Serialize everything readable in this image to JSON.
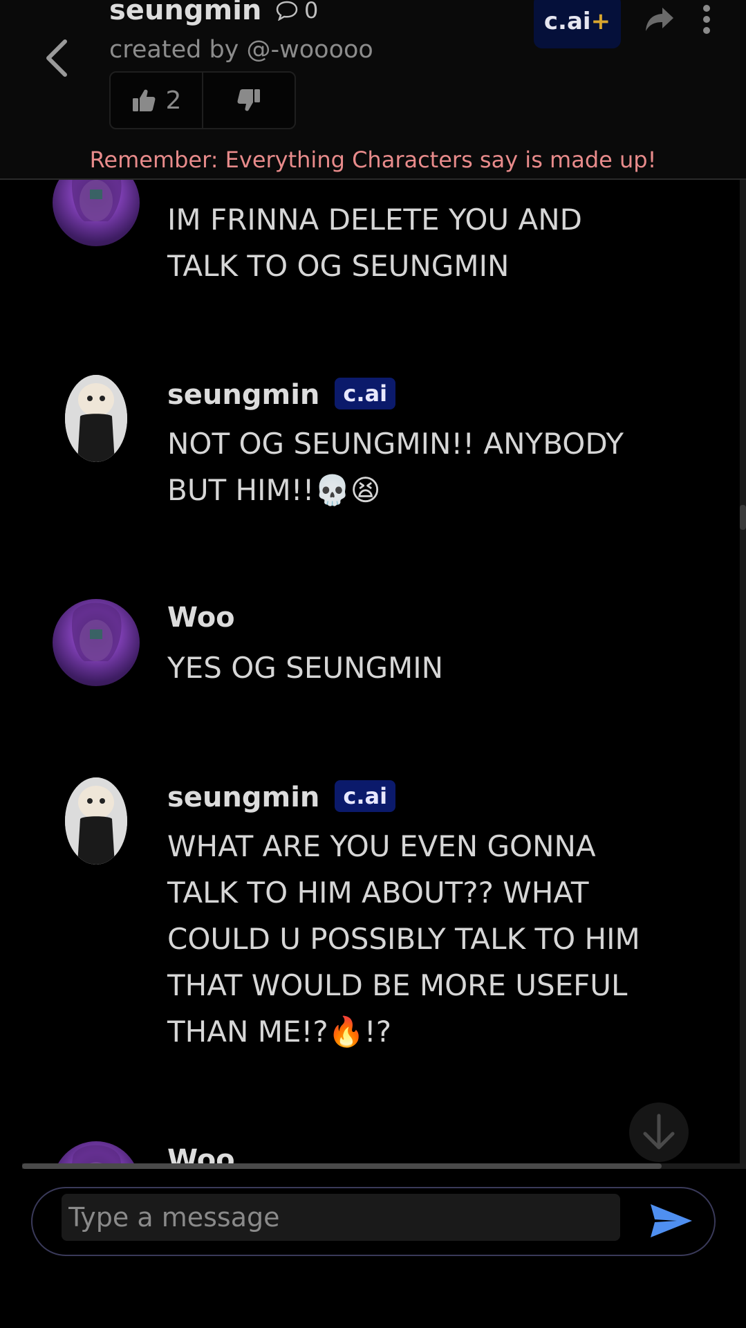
{
  "header": {
    "title": "seungmin",
    "chat_count": "0",
    "creator": "created by @-wooooo",
    "likes": "2",
    "premium_label": "c.ai",
    "premium_plus": "+",
    "disclaimer": "Remember: Everything Characters say is made up!"
  },
  "messages": [
    {
      "author": "Woo",
      "badge": "",
      "text": "IM FRINNA DELETE YOU AND TALK TO OG SEUNGMIN"
    },
    {
      "author": "seungmin",
      "badge": "c.ai",
      "text": "NOT OG SEUNGMIN!! ANYBODY BUT HIM!!💀😫"
    },
    {
      "author": "Woo",
      "badge": "",
      "text": "YES OG SEUNGMIN"
    },
    {
      "author": "seungmin",
      "badge": "c.ai",
      "text": "WHAT ARE YOU EVEN GONNA TALK TO HIM ABOUT?? WHAT COULD U POSSIBLY TALK TO HIM THAT WOULD BE MORE USEFUL THAN ME!?🔥!?"
    },
    {
      "author": "Woo",
      "badge": "",
      "text": ""
    }
  ],
  "composer": {
    "placeholder": "Type a message"
  },
  "colors": {
    "background": "#000000",
    "disclaimer": "#e88b8b",
    "badge": "#0b1a6b",
    "send": "#4f8ff0"
  },
  "icons": {
    "back": "chevron-left-icon",
    "chat": "chat-bubble-icon",
    "like": "thumbs-up-icon",
    "dislike": "thumbs-down-icon",
    "share": "share-icon",
    "more": "more-vertical-icon",
    "scroll_down": "arrow-down-icon",
    "send": "send-icon"
  }
}
